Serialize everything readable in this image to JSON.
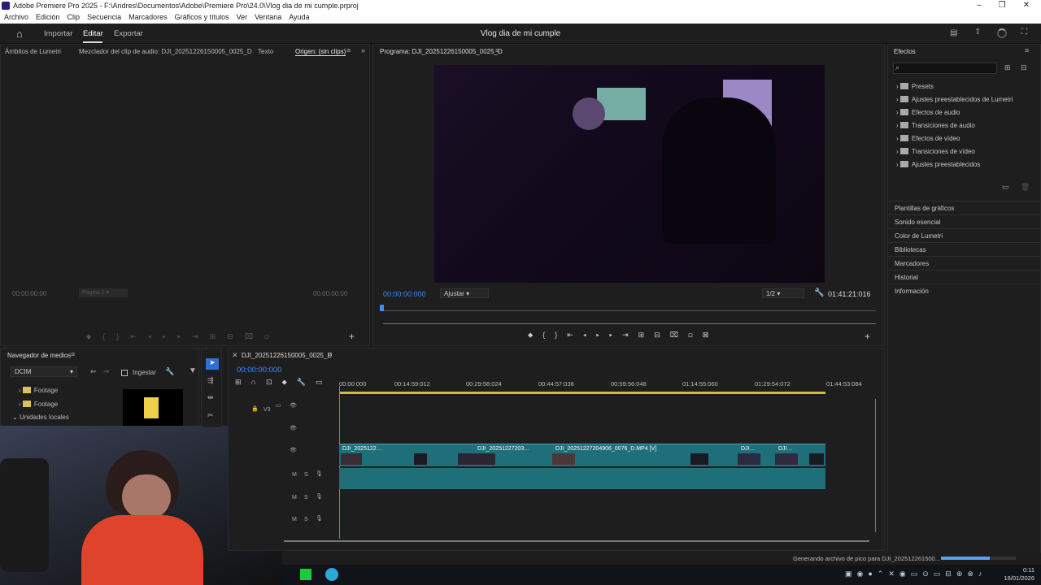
{
  "window": {
    "title": "Adobe Premiere Pro 2025 - F:\\Andres\\Documentos\\Adobe\\Premiere Pro\\24.0\\Vlog dia de mi cumple.prproj"
  },
  "menu": [
    "Archivo",
    "Edición",
    "Clip",
    "Secuencia",
    "Marcadores",
    "Gráficos y títulos",
    "Ver",
    "Ventana",
    "Ayuda"
  ],
  "appbar": {
    "import": "Importar",
    "edit": "Editar",
    "export": "Exportar",
    "project_title": "Vlog dia de mi cumple"
  },
  "source_panel": {
    "tabs": [
      "Ámbitos de Lumetri",
      "Mezclador del clip de audio: DJI_20251226150005_0025_D",
      "Texto",
      "Origen: (sin clips)"
    ],
    "timecode_in": "00:00:00:00",
    "page": "Página 1",
    "timecode_out": "00:00:00:00"
  },
  "program_panel": {
    "title": "Programa: DJI_20251226150005_0025_D",
    "timecode": "00:00:00:000",
    "fit": "Ajustar",
    "resolution": "1/2",
    "duration": "01:41:21:016"
  },
  "effects_panel": {
    "title": "Efectos",
    "items": [
      "Presets",
      "Ajustes preestablecidos de Lumetri",
      "Efectos de audio",
      "Transiciones de audio",
      "Efectos de vídeo",
      "Transiciones de vídeo",
      "Ajustes preestablecidos"
    ],
    "sections": [
      "Plantillas de gráficos",
      "Sonido esencial",
      "Color de Lumetri",
      "Bibliotecas",
      "Marcadores",
      "Historial",
      "Información"
    ]
  },
  "media_browser": {
    "title": "Navegador de medios",
    "location": "DCIM",
    "ingest": "Ingestar",
    "tree": [
      "Footage",
      "Footage",
      "Unidades locales"
    ]
  },
  "timeline": {
    "sequence": "DJI_20251226150005_0025_D",
    "timecode": "00:00:00:000",
    "ruler": [
      "00:00:000",
      "00:14:59:012",
      "00:29:58:024",
      "00:44:57:036",
      "00:59:56:048",
      "01:14:55:060",
      "01:29:54:072",
      "01:44:53:084"
    ],
    "tracks": {
      "v3": "V3",
      "mute": "M",
      "solo": "S"
    },
    "clips": [
      "DJI_2025122…",
      "DJI_20251227203…",
      "DJI_20251227204906_0076_D.MP4 [V]",
      "DJI…",
      "DJI…"
    ]
  },
  "status": {
    "text": "Generando archivo de pico para DJI_202512261500...",
    "progress": 0.65
  },
  "taskbar": {
    "time": "0:11",
    "date": "16/01/2026"
  }
}
